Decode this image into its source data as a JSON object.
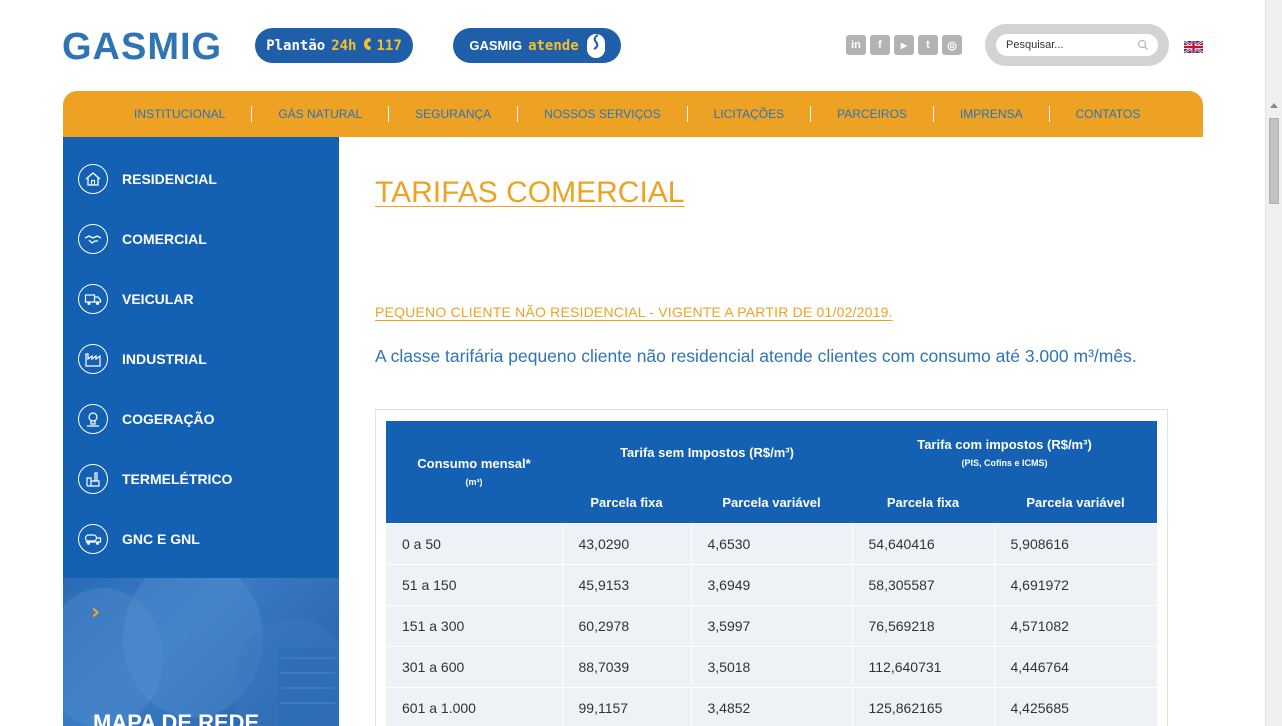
{
  "header": {
    "logo": "GASMIG",
    "plantao": {
      "label": "Plantão",
      "hours": "24h",
      "phone_icon": "phone-icon",
      "number": "117"
    },
    "atende": {
      "brand": "GASMIG",
      "label": "atende"
    },
    "social": [
      {
        "name": "linkedin",
        "glyph": "in"
      },
      {
        "name": "facebook",
        "glyph": "f"
      },
      {
        "name": "youtube",
        "glyph": "▶"
      },
      {
        "name": "twitter",
        "glyph": "t"
      },
      {
        "name": "instagram",
        "glyph": "◎"
      }
    ],
    "search": {
      "placeholder": "Pesquisar..."
    },
    "language_flag": "uk-flag-icon"
  },
  "nav": {
    "items": [
      "INSTITUCIONAL",
      "GÁS NATURAL",
      "SEGURANÇA",
      "NOSSOS SERVIÇOS",
      "LICITAÇÕES",
      "PARCEIROS",
      "IMPRENSA",
      "CONTATOS"
    ]
  },
  "sidebar": {
    "items": [
      {
        "label": "RESIDENCIAL",
        "icon": "house-icon"
      },
      {
        "label": "COMERCIAL",
        "icon": "handshake-icon"
      },
      {
        "label": "VEICULAR",
        "icon": "truck-icon"
      },
      {
        "label": "INDUSTRIAL",
        "icon": "factory-icon"
      },
      {
        "label": "COGERAÇÃO",
        "icon": "lightbulb-icon"
      },
      {
        "label": "TERMELÉTRICO",
        "icon": "power-plant-icon"
      },
      {
        "label": "GNC E GNL",
        "icon": "tanker-truck-icon"
      }
    ],
    "promo": {
      "arrow": "›",
      "title": "MAPA DE REDE"
    }
  },
  "main": {
    "title": "TARIFAS COMERCIAL",
    "subheading": "PEQUENO CLIENTE NÃO RESIDENCIAL - VIGENTE A PARTIR DE 01/02/2019.",
    "description": "A classe tarifária pequeno cliente não residencial atende clientes com consumo até 3.000 m³/mês.",
    "table": {
      "col_consumo": "Consumo mensal*",
      "col_consumo_unit": "(m³)",
      "col_sem": "Tarifa sem Impostos (R$/m³)",
      "col_com": "Tarifa com impostos (R$/m³)",
      "col_com_note": "(PIS, Cofins e ICMS)",
      "sub_fixa_1": "Parcela fixa",
      "sub_var_1": "Parcela variável",
      "sub_fixa_2": "Parcela fixa",
      "sub_var_2": "Parcela variável",
      "rows": [
        [
          "0 a 50",
          "43,0290",
          "4,6530",
          "54,640416",
          "5,908616"
        ],
        [
          "51 a 150",
          "45,9153",
          "3,6949",
          "58,305587",
          "4,691972"
        ],
        [
          "151 a 300",
          "60,2978",
          "3,5997",
          "76,569218",
          "4,571082"
        ],
        [
          "301 a 600",
          "88,7039",
          "3,5018",
          "112,640731",
          "4,446764"
        ],
        [
          "601 a 1.000",
          "99,1157",
          "3,4852",
          "125,862165",
          "4,425685"
        ]
      ]
    }
  },
  "colors": {
    "brand_blue": "#1460b2",
    "accent_orange": "#eda223",
    "link_blue": "#2f74b5"
  }
}
